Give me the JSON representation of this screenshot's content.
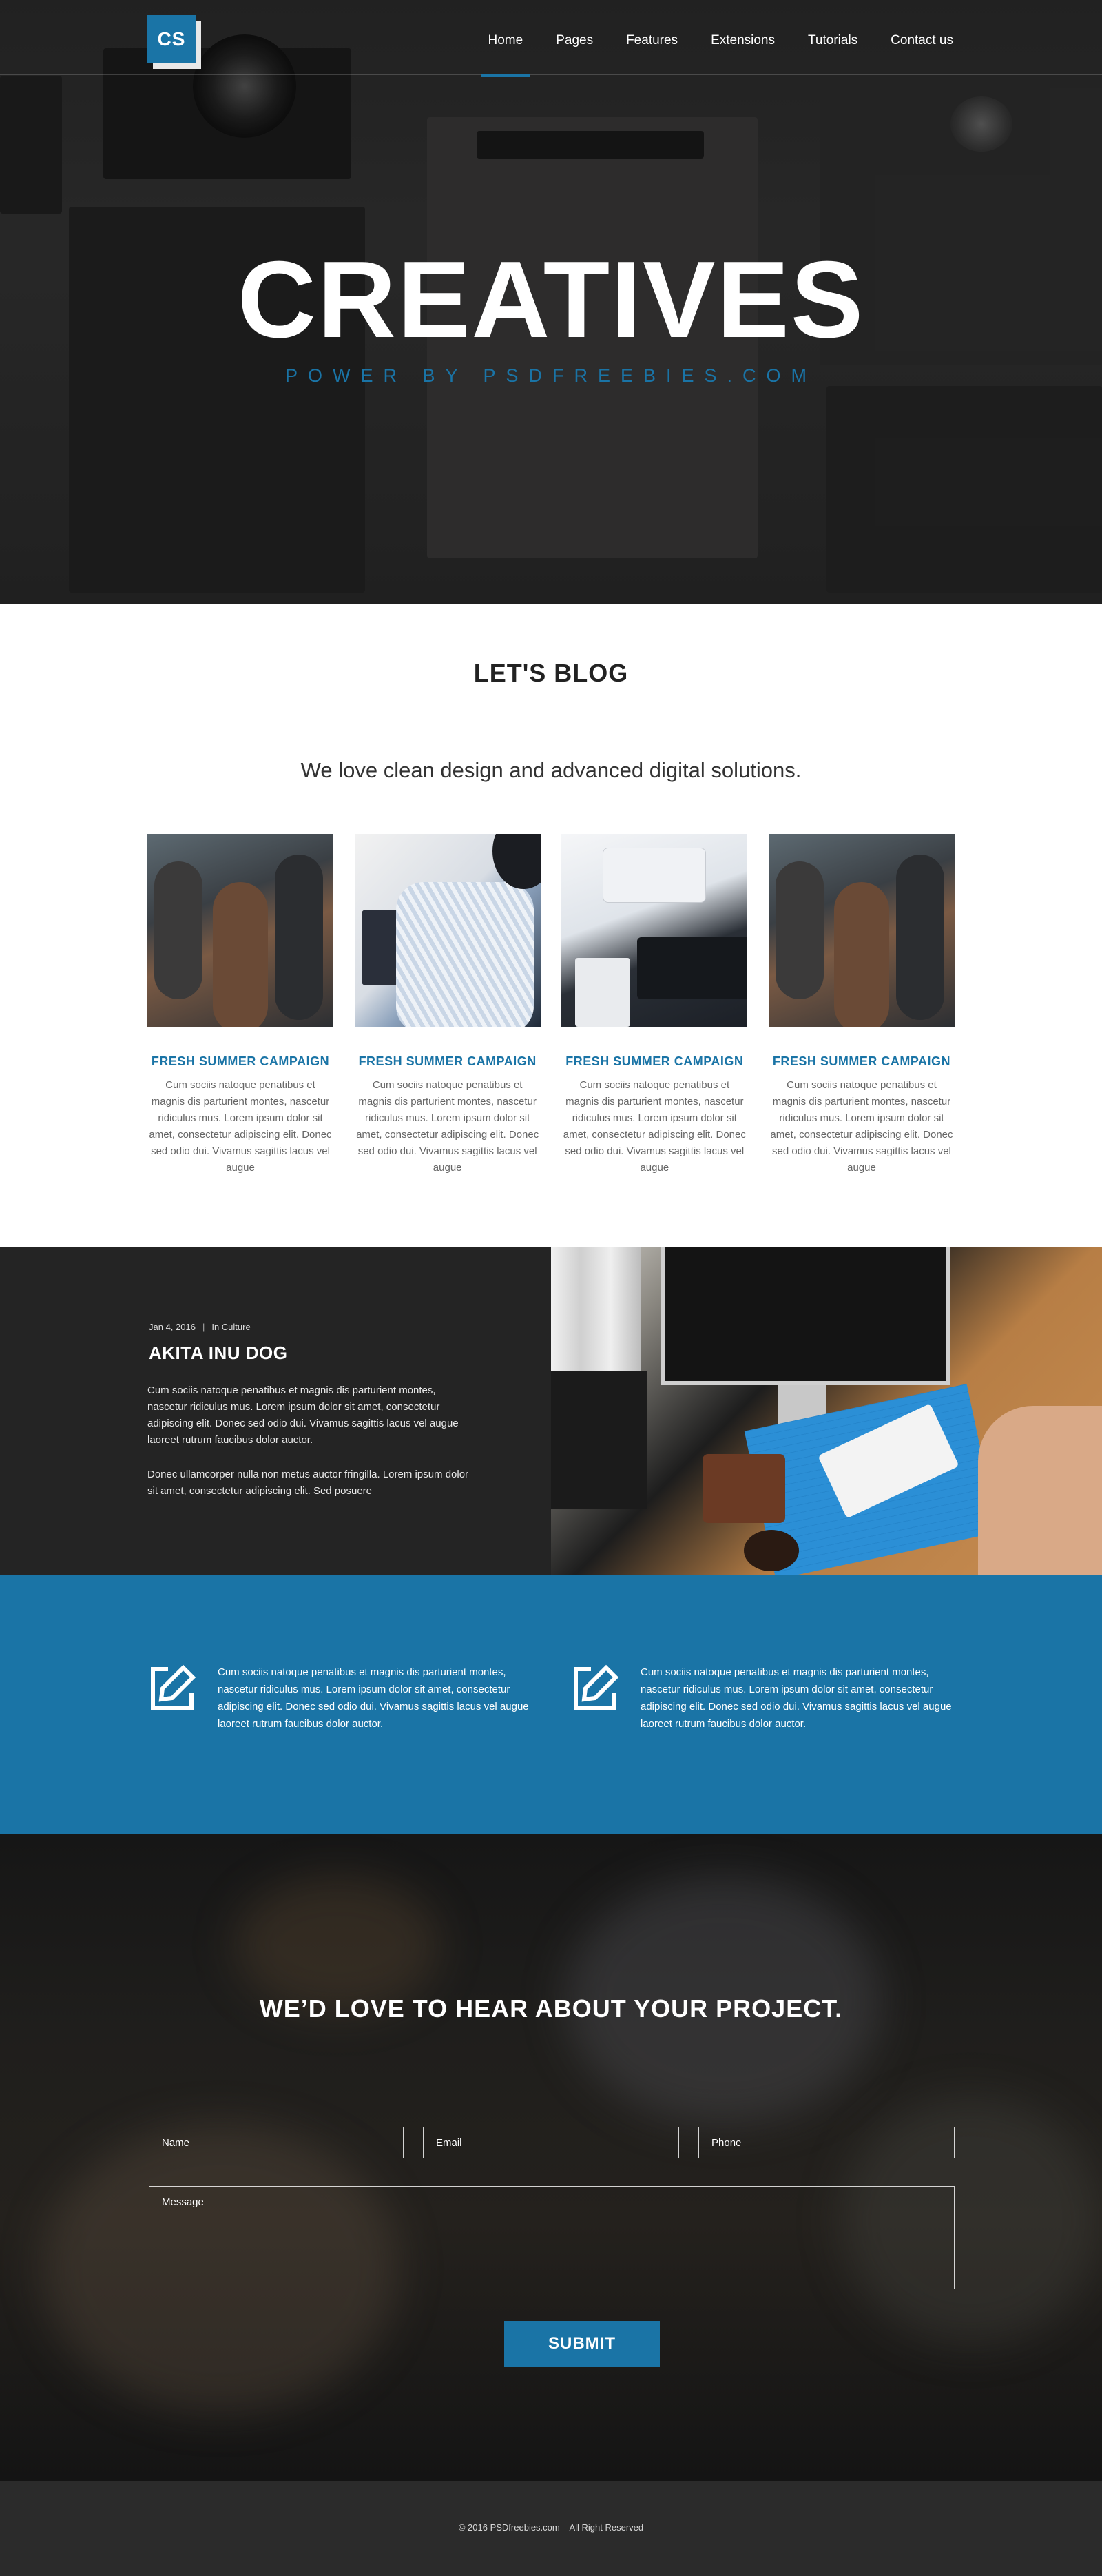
{
  "colors": {
    "accent": "#1a74a6",
    "dark": "#242424",
    "white": "#ffffff"
  },
  "header": {
    "logo": "CS",
    "nav": [
      {
        "label": "Home",
        "active": true
      },
      {
        "label": "Pages",
        "active": false
      },
      {
        "label": "Features",
        "active": false
      },
      {
        "label": "Extensions",
        "active": false
      },
      {
        "label": "Tutorials",
        "active": false
      },
      {
        "label": "Contact us",
        "active": false
      }
    ]
  },
  "hero": {
    "title": "CREATIVES",
    "subtitle": "POWER BY PSDFREEBIES.COM"
  },
  "blog": {
    "title": "LET'S BLOG",
    "tagline": "We love clean design and advanced digital solutions.",
    "cards": [
      {
        "title": "FRESH SUMMER CAMPAIGN",
        "text": "Cum sociis natoque penatibus et magnis dis parturient montes, nascetur ridiculus mus. Lorem ipsum dolor sit amet, consectetur adipiscing elit. Donec sed odio dui. Vivamus sagittis lacus vel augue",
        "image": "team-photo"
      },
      {
        "title": "FRESH SUMMER CAMPAIGN",
        "text": "Cum sociis natoque penatibus et magnis dis parturient montes, nascetur ridiculus mus. Lorem ipsum dolor sit amet, consectetur adipiscing elit. Donec sed odio dui. Vivamus sagittis lacus vel augue",
        "image": "tablet-photo"
      },
      {
        "title": "FRESH SUMMER CAMPAIGN",
        "text": "Cum sociis natoque penatibus et magnis dis parturient montes, nascetur ridiculus mus. Lorem ipsum dolor sit amet, consectetur adipiscing elit. Donec sed odio dui. Vivamus sagittis lacus vel augue",
        "image": "keyboard-photo"
      },
      {
        "title": "FRESH SUMMER CAMPAIGN",
        "text": "Cum sociis natoque penatibus et magnis dis parturient montes, nascetur ridiculus mus. Lorem ipsum dolor sit amet, consectetur adipiscing elit. Donec sed odio dui. Vivamus sagittis lacus vel augue",
        "image": "team-photo"
      }
    ]
  },
  "feature": {
    "date": "Jan 4, 2016",
    "category": "In Culture",
    "title": "AKITA INU DOG",
    "paragraph1": "Cum sociis natoque penatibus et magnis dis parturient montes, nascetur ridiculus mus. Lorem ipsum dolor sit amet, consectetur adipiscing elit. Donec sed odio dui. Vivamus sagittis lacus vel augue laoreet rutrum faucibus dolor auctor.",
    "paragraph2": "Donec ullamcorper nulla non metus auctor fringilla. Lorem ipsum dolor sit amet, consectetur adipiscing elit. Sed posuere"
  },
  "services": [
    {
      "icon": "edit-icon",
      "text": "Cum sociis natoque penatibus et magnis dis parturient montes, nascetur ridiculus mus. Lorem ipsum dolor sit amet, consectetur adipiscing elit. Donec sed odio dui. Vivamus sagittis lacus vel augue laoreet rutrum faucibus dolor auctor."
    },
    {
      "icon": "edit-icon",
      "text": "Cum sociis natoque penatibus et magnis dis parturient montes, nascetur ridiculus mus. Lorem ipsum dolor sit amet, consectetur adipiscing elit. Donec sed odio dui. Vivamus sagittis lacus vel augue laoreet rutrum faucibus dolor auctor."
    }
  ],
  "contact": {
    "title": "WE’D LOVE TO HEAR ABOUT YOUR PROJECT.",
    "name_placeholder": "Name",
    "email_placeholder": "Email",
    "phone_placeholder": "Phone",
    "message_placeholder": "Message",
    "submit_label": "SUBMIT"
  },
  "footer": {
    "copyright": "© 2016 PSDfreebies.com – All Right Reserved"
  }
}
